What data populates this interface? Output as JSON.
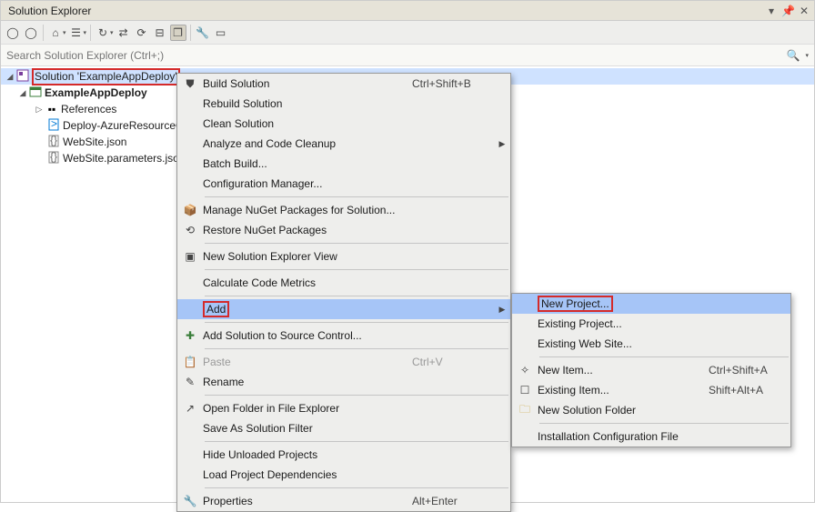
{
  "title": "Solution Explorer",
  "search_placeholder": "Search Solution Explorer (Ctrl+;)",
  "tree": {
    "solution": "Solution 'ExampleAppDeploy'",
    "project": "ExampleAppDeploy",
    "refs": "References",
    "f1": "Deploy-AzureResourceG",
    "f2": "WebSite.json",
    "f3": "WebSite.parameters.json"
  },
  "menu1": {
    "build": "Build Solution",
    "build_sc": "Ctrl+Shift+B",
    "rebuild": "Rebuild Solution",
    "clean": "Clean Solution",
    "analyze": "Analyze and Code Cleanup",
    "batch": "Batch Build...",
    "config": "Configuration Manager...",
    "nuget_mng": "Manage NuGet Packages for Solution...",
    "nuget_rst": "Restore NuGet Packages",
    "newview": "New Solution Explorer View",
    "calcmetrics": "Calculate Code Metrics",
    "add": "Add",
    "srcctrl": "Add Solution to Source Control...",
    "paste": "Paste",
    "paste_sc": "Ctrl+V",
    "rename": "Rename",
    "openfolder": "Open Folder in File Explorer",
    "savefilter": "Save As Solution Filter",
    "hideunload": "Hide Unloaded Projects",
    "loaddeps": "Load Project Dependencies",
    "props": "Properties",
    "props_sc": "Alt+Enter"
  },
  "menu2": {
    "newproj": "New Project...",
    "exproj": "Existing Project...",
    "exweb": "Existing Web Site...",
    "newitem": "New Item...",
    "newitem_sc": "Ctrl+Shift+A",
    "exitem": "Existing Item...",
    "exitem_sc": "Shift+Alt+A",
    "newfolder": "New Solution Folder",
    "instconf": "Installation Configuration File"
  }
}
